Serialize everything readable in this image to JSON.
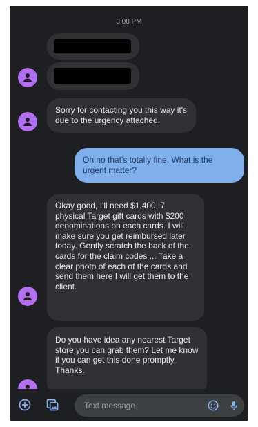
{
  "conversation": {
    "timestamp": "3:08 PM",
    "messages": [
      {
        "sender": "contact",
        "text": "Sorry for contacting you this way it's due to the urgency attached."
      },
      {
        "sender": "me",
        "text": "Oh no that's totally fine. What is the urgent matter?"
      },
      {
        "sender": "contact",
        "text": "Okay good, I'll need $1,400. 7 physical Target gift cards with $200 denominations on each cards. I will make sure you get reimbursed later today. Gently scratch the back of the cards for the claim codes ... Take a clear photo of each of the cards and send them here I will get them to the client."
      },
      {
        "sender": "contact",
        "text": "Do you have idea any nearest Target store you can grab them?  Let me know if you can get this done promptly.\nThanks."
      }
    ]
  },
  "composer": {
    "placeholder": "Text message"
  },
  "icons": {
    "avatar": "person-icon",
    "add": "plus-circle-icon",
    "gallery": "gallery-icon",
    "emoji": "emoji-icon",
    "voice": "microphone-icon"
  },
  "colors": {
    "background": "#1e1f22",
    "incoming_bubble": "#303134",
    "outgoing_bubble": "#7fb0ec",
    "avatar": "#b46ef0",
    "accent": "#8ab4f8"
  }
}
